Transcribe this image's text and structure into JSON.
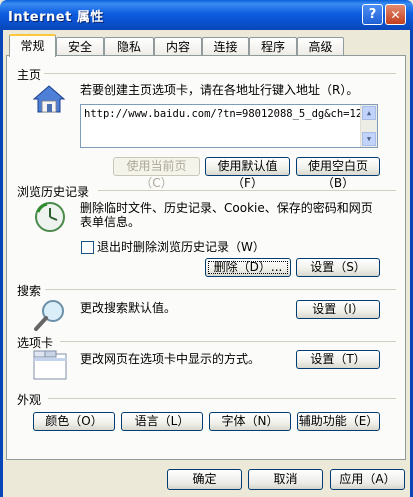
{
  "window": {
    "title": "Internet 属性",
    "help": "?",
    "close": "✕"
  },
  "tabs": [
    "常规",
    "安全",
    "隐私",
    "内容",
    "连接",
    "程序",
    "高级"
  ],
  "home": {
    "heading": "主页",
    "desc": "若要创建主页选项卡，请在各地址行键入地址（R）。",
    "url": "http://www.baidu.com/?tn=98012088_5_dg&ch=12",
    "btn_current": "使用当前页（C）",
    "btn_default": "使用默认值（F）",
    "btn_blank": "使用空白页（B）"
  },
  "history": {
    "heading": "浏览历史记录",
    "desc1": "删除临时文件、历史记录、Cookie、保存的密码和网页",
    "desc2": "表单信息。",
    "checkbox": "退出时删除浏览历史记录（W）",
    "btn_delete": "删除（D）...",
    "btn_settings": "设置（S）"
  },
  "search": {
    "heading": "搜索",
    "desc": "更改搜索默认值。",
    "btn_settings": "设置（I）"
  },
  "tabsection": {
    "heading": "选项卡",
    "desc": "更改网页在选项卡中显示的方式。",
    "btn_settings": "设置（T）"
  },
  "appearance": {
    "heading": "外观",
    "btn_colors": "颜色（O）",
    "btn_languages": "语言（L）",
    "btn_fonts": "字体（N）",
    "btn_accessibility": "辅助功能（E）"
  },
  "footer": {
    "ok": "确定",
    "cancel": "取消",
    "apply": "应用（A）"
  }
}
